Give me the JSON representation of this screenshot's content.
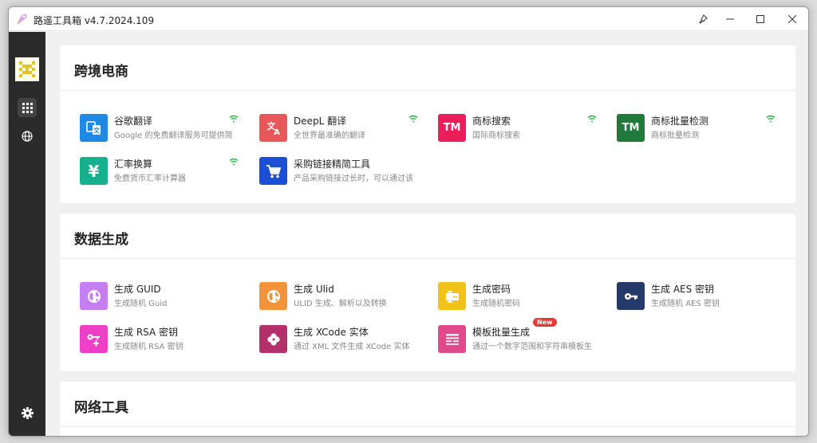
{
  "window": {
    "title": "路遥工具箱 v4.7.2024.109"
  },
  "sections": [
    {
      "title": "跨境电商",
      "tools": [
        {
          "name": "谷歌翻译",
          "desc": "Google 的免费翻译服务可提供简",
          "icon": "translate-icon",
          "color": "#1e88e5"
        },
        {
          "name": "DeepL 翻译",
          "desc": "全世界最准确的翻译",
          "icon": "translate-ai-icon",
          "color": "#e8585a"
        },
        {
          "name": "商标搜索",
          "desc": "国际商标搜索",
          "icon": "tm-icon",
          "color": "#e91e5a",
          "glyph": "TM"
        },
        {
          "name": "商标批量检测",
          "desc": "商标批量检测",
          "icon": "tm-icon",
          "color": "#1f7a3c",
          "glyph": "TM"
        },
        {
          "name": "汇率换算",
          "desc": "免费货币汇率计算器",
          "icon": "yen-icon",
          "color": "#16b08f",
          "glyph": "¥"
        },
        {
          "name": "采购链接精简工具",
          "desc": "产品采购链接过长时，可以通过该",
          "icon": "cart-icon",
          "color": "#1a4fd6"
        }
      ]
    },
    {
      "title": "数据生成",
      "tools": [
        {
          "name": "生成 GUID",
          "desc": "生成随机 Guid",
          "icon": "globe-icon",
          "color": "#c77ef0"
        },
        {
          "name": "生成 Ulid",
          "desc": "ULID 生成、解析以及转换",
          "icon": "globe-icon",
          "color": "#f4943a"
        },
        {
          "name": "生成密码",
          "desc": "生成随机密码",
          "icon": "password-icon",
          "color": "#f2c21a"
        },
        {
          "name": "生成 AES 密钥",
          "desc": "生成随机 AES 密钥",
          "icon": "key-icon",
          "color": "#243a6b"
        },
        {
          "name": "生成 RSA 密钥",
          "desc": "生成随机 RSA 密钥",
          "icon": "key-plus-icon",
          "color": "#ee3fc7"
        },
        {
          "name": "生成 XCode 实体",
          "desc": "通过 XML 文件生成 XCode 实体",
          "icon": "clover-icon",
          "color": "#b3306a"
        },
        {
          "name": "模板批量生成",
          "desc": "通过一个数字范围和字符串模板生",
          "icon": "template-icon",
          "color": "#e04a8a",
          "badge": "New"
        }
      ]
    },
    {
      "title": "网络工具",
      "tools": []
    }
  ],
  "colors": {
    "sidebar": "#2b2b2b",
    "wifi": "#2eb84a",
    "badge": "#e53935"
  }
}
